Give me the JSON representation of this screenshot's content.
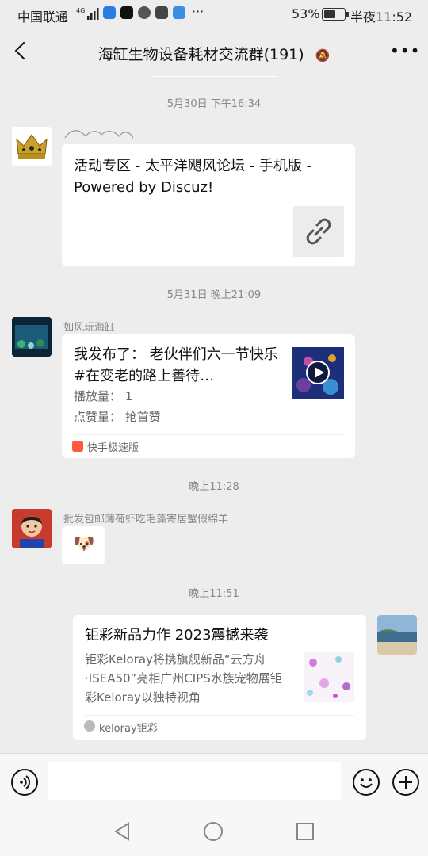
{
  "status_bar": {
    "carrier": "中国联通",
    "network": "4G",
    "dots": "···",
    "battery": "53%",
    "time": "半夜11:52"
  },
  "header": {
    "back_icon": "chevron-left-icon",
    "title": "海缸生物设备耗材交流群(191)",
    "mute_icon": "bell-off-icon",
    "more_icon": "more-icon"
  },
  "messages": {
    "ts1": "5月30日 下午16:34",
    "msg1": {
      "link_title": "活动专区 - 太平洋飓风论坛 - 手机版 - Powered by Discuz!",
      "link_icon": "link-icon"
    },
    "ts2": "5月31日 晚上21:09",
    "msg2": {
      "sender": "如风玩海缸",
      "title": "我发布了：  老伙伴们六一节快乐 #在变老的路上善待…",
      "plays": "播放量：  1",
      "likes": "点赞量：  抢首赞",
      "source": "快手极速版"
    },
    "ts3": "晚上11:28",
    "msg3": {
      "sender": "批发包邮薄荷虾吃毛藻寄居蟹假绵羊",
      "emoji": "🐶"
    },
    "ts4": "晚上11:51",
    "msg4": {
      "title": "钜彩新品力作 2023震撼来袭",
      "desc": "钜彩Keloray将携旗舰新品“云方舟·ISEA50”亮相广州CIPS水族宠物展钜彩Keloray以独特视角",
      "source": "keloray钜彩"
    }
  },
  "input_bar": {
    "voice_icon": "voice-icon",
    "emoji_icon": "emoji-icon",
    "plus_icon": "plus-icon",
    "value": ""
  },
  "nav": {
    "back": "nav-back-icon",
    "home": "nav-home-icon",
    "recent": "nav-recent-icon"
  },
  "colors": {
    "background": "#ededed",
    "bubble": "#ffffff",
    "timestamp": "#888888"
  }
}
